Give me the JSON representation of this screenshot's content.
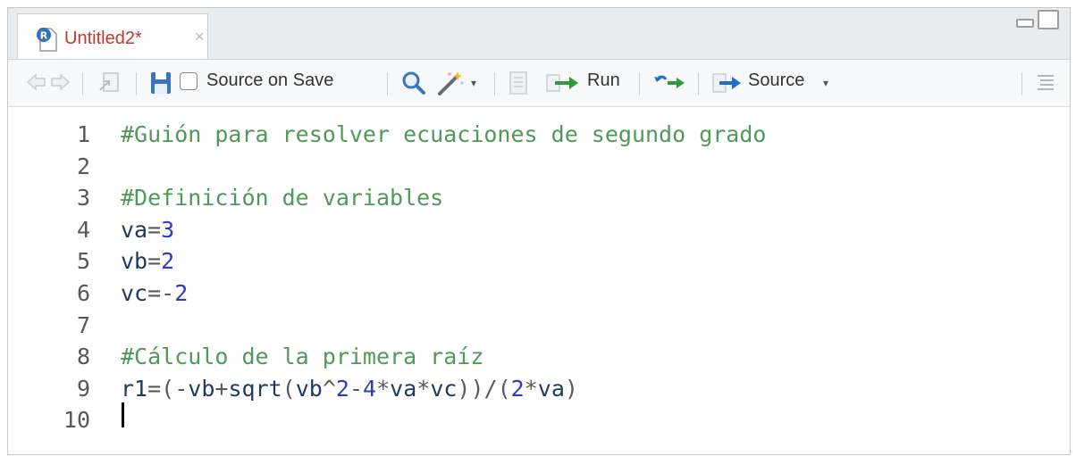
{
  "tab": {
    "title": "Untitled2*",
    "close": "×"
  },
  "toolbar": {
    "source_on_save": "Source on Save",
    "source_on_save_checked": false,
    "run": "Run",
    "source": "Source"
  },
  "editor": {
    "lines": [
      {
        "n": "1",
        "tokens": [
          {
            "t": "#Guión para resolver ecuaciones de segundo grado",
            "k": "comment"
          }
        ]
      },
      {
        "n": "2",
        "tokens": []
      },
      {
        "n": "3",
        "tokens": [
          {
            "t": "#Definición de variables",
            "k": "comment"
          }
        ]
      },
      {
        "n": "4",
        "tokens": [
          {
            "t": "va",
            "k": "ident"
          },
          {
            "t": "=",
            "k": "op"
          },
          {
            "t": "3",
            "k": "num"
          }
        ]
      },
      {
        "n": "5",
        "tokens": [
          {
            "t": "vb",
            "k": "ident"
          },
          {
            "t": "=",
            "k": "op"
          },
          {
            "t": "2",
            "k": "num"
          }
        ]
      },
      {
        "n": "6",
        "tokens": [
          {
            "t": "vc",
            "k": "ident"
          },
          {
            "t": "=-",
            "k": "op"
          },
          {
            "t": "2",
            "k": "num"
          }
        ]
      },
      {
        "n": "7",
        "tokens": []
      },
      {
        "n": "8",
        "tokens": [
          {
            "t": "#Cálculo de la primera raíz",
            "k": "comment"
          }
        ]
      },
      {
        "n": "9",
        "tokens": [
          {
            "t": "r1",
            "k": "ident"
          },
          {
            "t": "=(-",
            "k": "op"
          },
          {
            "t": "vb",
            "k": "ident"
          },
          {
            "t": "+",
            "k": "op"
          },
          {
            "t": "sqrt",
            "k": "ident"
          },
          {
            "t": "(",
            "k": "op"
          },
          {
            "t": "vb",
            "k": "ident"
          },
          {
            "t": "^",
            "k": "op"
          },
          {
            "t": "2",
            "k": "num"
          },
          {
            "t": "-",
            "k": "op"
          },
          {
            "t": "4",
            "k": "num"
          },
          {
            "t": "*",
            "k": "op"
          },
          {
            "t": "va",
            "k": "ident"
          },
          {
            "t": "*",
            "k": "op"
          },
          {
            "t": "vc",
            "k": "ident"
          },
          {
            "t": "))/(",
            "k": "op"
          },
          {
            "t": "2",
            "k": "num"
          },
          {
            "t": "*",
            "k": "op"
          },
          {
            "t": "va",
            "k": "ident"
          },
          {
            "t": ")",
            "k": "op"
          }
        ]
      },
      {
        "n": "10",
        "tokens": []
      }
    ]
  },
  "icons": {
    "tab_file": "r-script-file-icon",
    "back": "back-arrow-icon",
    "forward": "forward-arrow-icon",
    "show_in_window": "show-in-new-window-icon",
    "save": "save-icon",
    "find": "search-icon",
    "code_tools": "magic-wand-icon",
    "compile_report": "compile-report-icon",
    "run": "run-arrow-icon",
    "rerun": "rerun-icon",
    "source": "source-arrow-icon",
    "outline": "document-outline-icon"
  },
  "colors": {
    "tab_title": "#c0392b",
    "comment": "#4f9a58",
    "number": "#2b3bc9",
    "run_arrow": "#2e9b3a",
    "rerun_arrow": "#1f6fd1"
  }
}
